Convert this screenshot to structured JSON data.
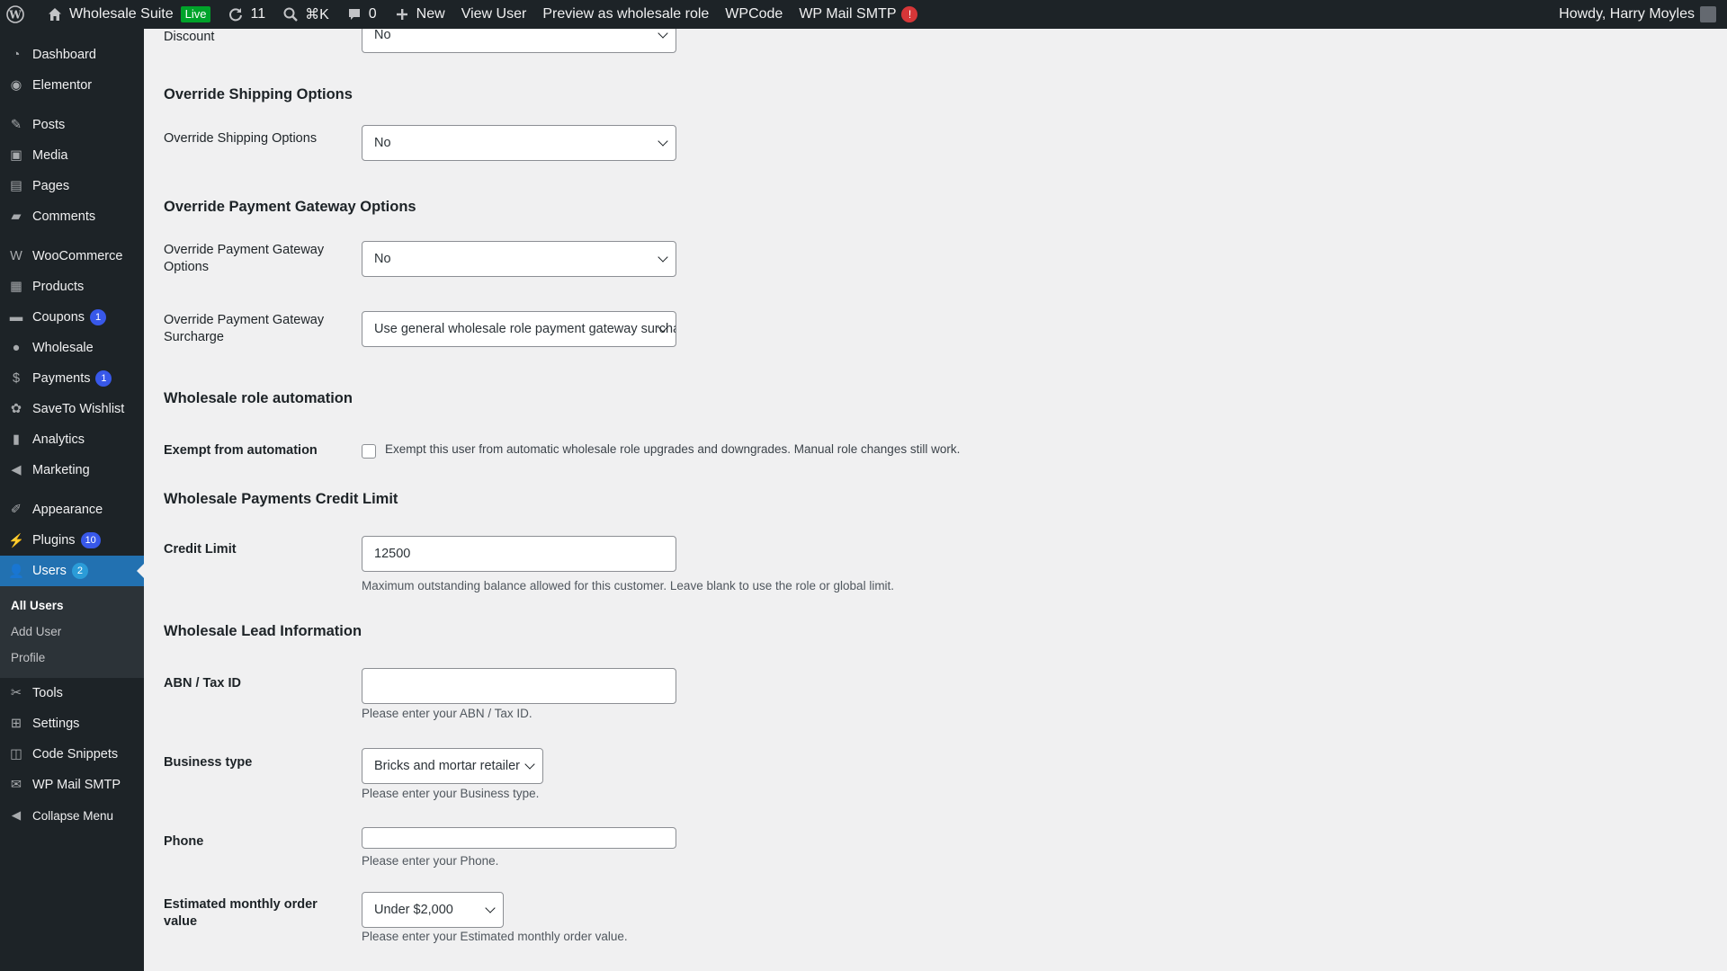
{
  "admin_bar": {
    "site_name": "Wholesale Suite",
    "live_badge": "Live",
    "updates_count": "11",
    "search_shortcut": "⌘K",
    "comments_count": "0",
    "new_label": "New",
    "view_user": "View User",
    "preview_role": "Preview as wholesale role",
    "wpcode": "WPCode",
    "wp_mail_smtp": "WP Mail SMTP",
    "smtp_alert": "!",
    "howdy": "Howdy, Harry Moyles"
  },
  "sidebar": {
    "items": [
      {
        "label": "Dashboard",
        "icon": "dashboard-icon"
      },
      {
        "label": "Elementor",
        "icon": "elementor-icon"
      },
      {
        "label": "Posts",
        "icon": "pin-icon"
      },
      {
        "label": "Media",
        "icon": "media-icon"
      },
      {
        "label": "Pages",
        "icon": "pages-icon"
      },
      {
        "label": "Comments",
        "icon": "comments-icon"
      },
      {
        "label": "WooCommerce",
        "icon": "woocommerce-icon"
      },
      {
        "label": "Products",
        "icon": "products-icon"
      },
      {
        "label": "Coupons",
        "icon": "coupons-icon",
        "badge": "1"
      },
      {
        "label": "Wholesale",
        "icon": "wholesale-icon"
      },
      {
        "label": "Payments",
        "icon": "payments-icon",
        "badge": "1"
      },
      {
        "label": "SaveTo Wishlist",
        "icon": "wishlist-icon"
      },
      {
        "label": "Analytics",
        "icon": "analytics-icon"
      },
      {
        "label": "Marketing",
        "icon": "marketing-icon"
      },
      {
        "label": "Appearance",
        "icon": "appearance-icon"
      },
      {
        "label": "Plugins",
        "icon": "plugins-icon",
        "badge": "10"
      },
      {
        "label": "Users",
        "icon": "users-icon",
        "badge": "2"
      },
      {
        "label": "Tools",
        "icon": "tools-icon"
      },
      {
        "label": "Settings",
        "icon": "settings-icon"
      },
      {
        "label": "Code Snippets",
        "icon": "code-snippets-icon"
      },
      {
        "label": "WP Mail SMTP",
        "icon": "mail-icon"
      },
      {
        "label": "Collapse Menu",
        "icon": "collapse-icon"
      }
    ],
    "users_submenu": [
      "All Users",
      "Add User",
      "Profile"
    ]
  },
  "form": {
    "discount_label": "Discount",
    "discount_value": "No",
    "shipping": {
      "section_title": "Override Shipping Options",
      "label": "Override Shipping Options",
      "value": "No"
    },
    "payment": {
      "section_title": "Override Payment Gateway Options",
      "label": "Override Payment Gateway Options",
      "value": "No",
      "surcharge_label": "Override Payment Gateway Surcharge",
      "surcharge_value": "Use general wholesale role payment gateway surcharge"
    },
    "automation": {
      "section_title": "Wholesale role automation",
      "label": "Exempt from automation",
      "checkbox_text": "Exempt this user from automatic wholesale role upgrades and downgrades. Manual role changes still work.",
      "checked": false
    },
    "credit": {
      "section_title": "Wholesale Payments Credit Limit",
      "label": "Credit Limit",
      "value": "12500",
      "description": "Maximum outstanding balance allowed for this customer. Leave blank to use the role or global limit."
    },
    "lead": {
      "section_title": "Wholesale Lead Information",
      "abn_label": "ABN / Tax ID",
      "abn_value": "",
      "abn_desc": "Please enter your ABN / Tax ID.",
      "business_label": "Business type",
      "business_value": "Bricks and mortar retailer",
      "business_desc": "Please enter your Business type.",
      "phone_label": "Phone",
      "phone_value": "",
      "phone_desc": "Please enter your Phone.",
      "order_label": "Estimated monthly order value",
      "order_value": "Under $2,000",
      "order_desc": "Please enter your Estimated monthly order value."
    }
  },
  "colors": {
    "admin_bg": "#1d2327",
    "accent": "#2271b1",
    "badge": "#3858e9",
    "alert": "#d63638",
    "live": "#00a32a"
  }
}
